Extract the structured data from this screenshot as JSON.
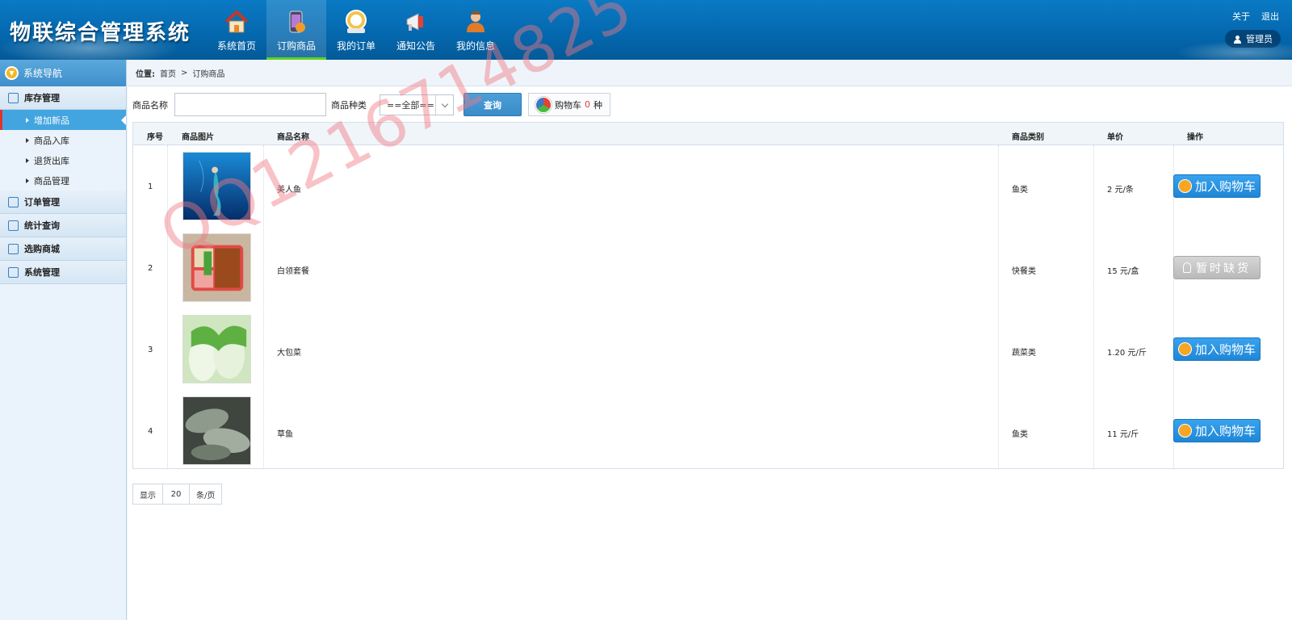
{
  "header": {
    "app_title": "物联综合管理系统",
    "nav": [
      {
        "label": "系统首页",
        "icon": "home-icon"
      },
      {
        "label": "订购商品",
        "icon": "phone-icon"
      },
      {
        "label": "我的订单",
        "icon": "order-icon"
      },
      {
        "label": "通知公告",
        "icon": "megaphone-icon"
      },
      {
        "label": "我的信息",
        "icon": "user-icon"
      }
    ],
    "active_nav": "订购商品",
    "links": {
      "about": "关于",
      "logout": "退出"
    },
    "user": "管理员"
  },
  "sidebar": {
    "title": "系统导航",
    "groups": [
      {
        "label": "库存管理"
      },
      {
        "label": "订单管理"
      },
      {
        "label": "统计查询"
      },
      {
        "label": "选购商城"
      },
      {
        "label": "系统管理"
      }
    ],
    "inventory_items": [
      "增加新品",
      "商品入库",
      "退货出库",
      "商品管理"
    ],
    "active_item": "增加新品"
  },
  "breadcrumb": {
    "prefix": "位置:",
    "home": "首页",
    "separator": ">",
    "current": "订购商品"
  },
  "filter": {
    "name_label": "商品名称",
    "name_value": "",
    "category_label": "商品种类",
    "category_selected": "==全部==",
    "query_button": "查询",
    "cart_label": "购物车",
    "cart_count": "0",
    "cart_unit": "种"
  },
  "table": {
    "headers": [
      "序号",
      "商品图片",
      "商品名称",
      "商品类别",
      "单价",
      "操作"
    ],
    "rows": [
      {
        "no": "1",
        "name": "美人鱼",
        "category": "鱼类",
        "price": "2  元/条",
        "action": "加入购物车",
        "status": "available"
      },
      {
        "no": "2",
        "name": "白领套餐",
        "category": "快餐类",
        "price": "15  元/盒",
        "action": "暂时缺货",
        "status": "out"
      },
      {
        "no": "3",
        "name": "大包菜",
        "category": "蔬菜类",
        "price": "1.20  元/斤",
        "action": "加入购物车",
        "status": "available"
      },
      {
        "no": "4",
        "name": "草鱼",
        "category": "鱼类",
        "price": "11  元/斤",
        "action": "加入购物车",
        "status": "available"
      }
    ]
  },
  "pager": {
    "show": "显示",
    "page_size": "20",
    "unit": "条/页"
  },
  "watermark": "QQ1216714825",
  "colors": {
    "header": "#0467ad",
    "accent": "#43a5df",
    "add_button": "#2a93e1",
    "cart_count": "#e34234",
    "active_marker": "#e0342a"
  }
}
